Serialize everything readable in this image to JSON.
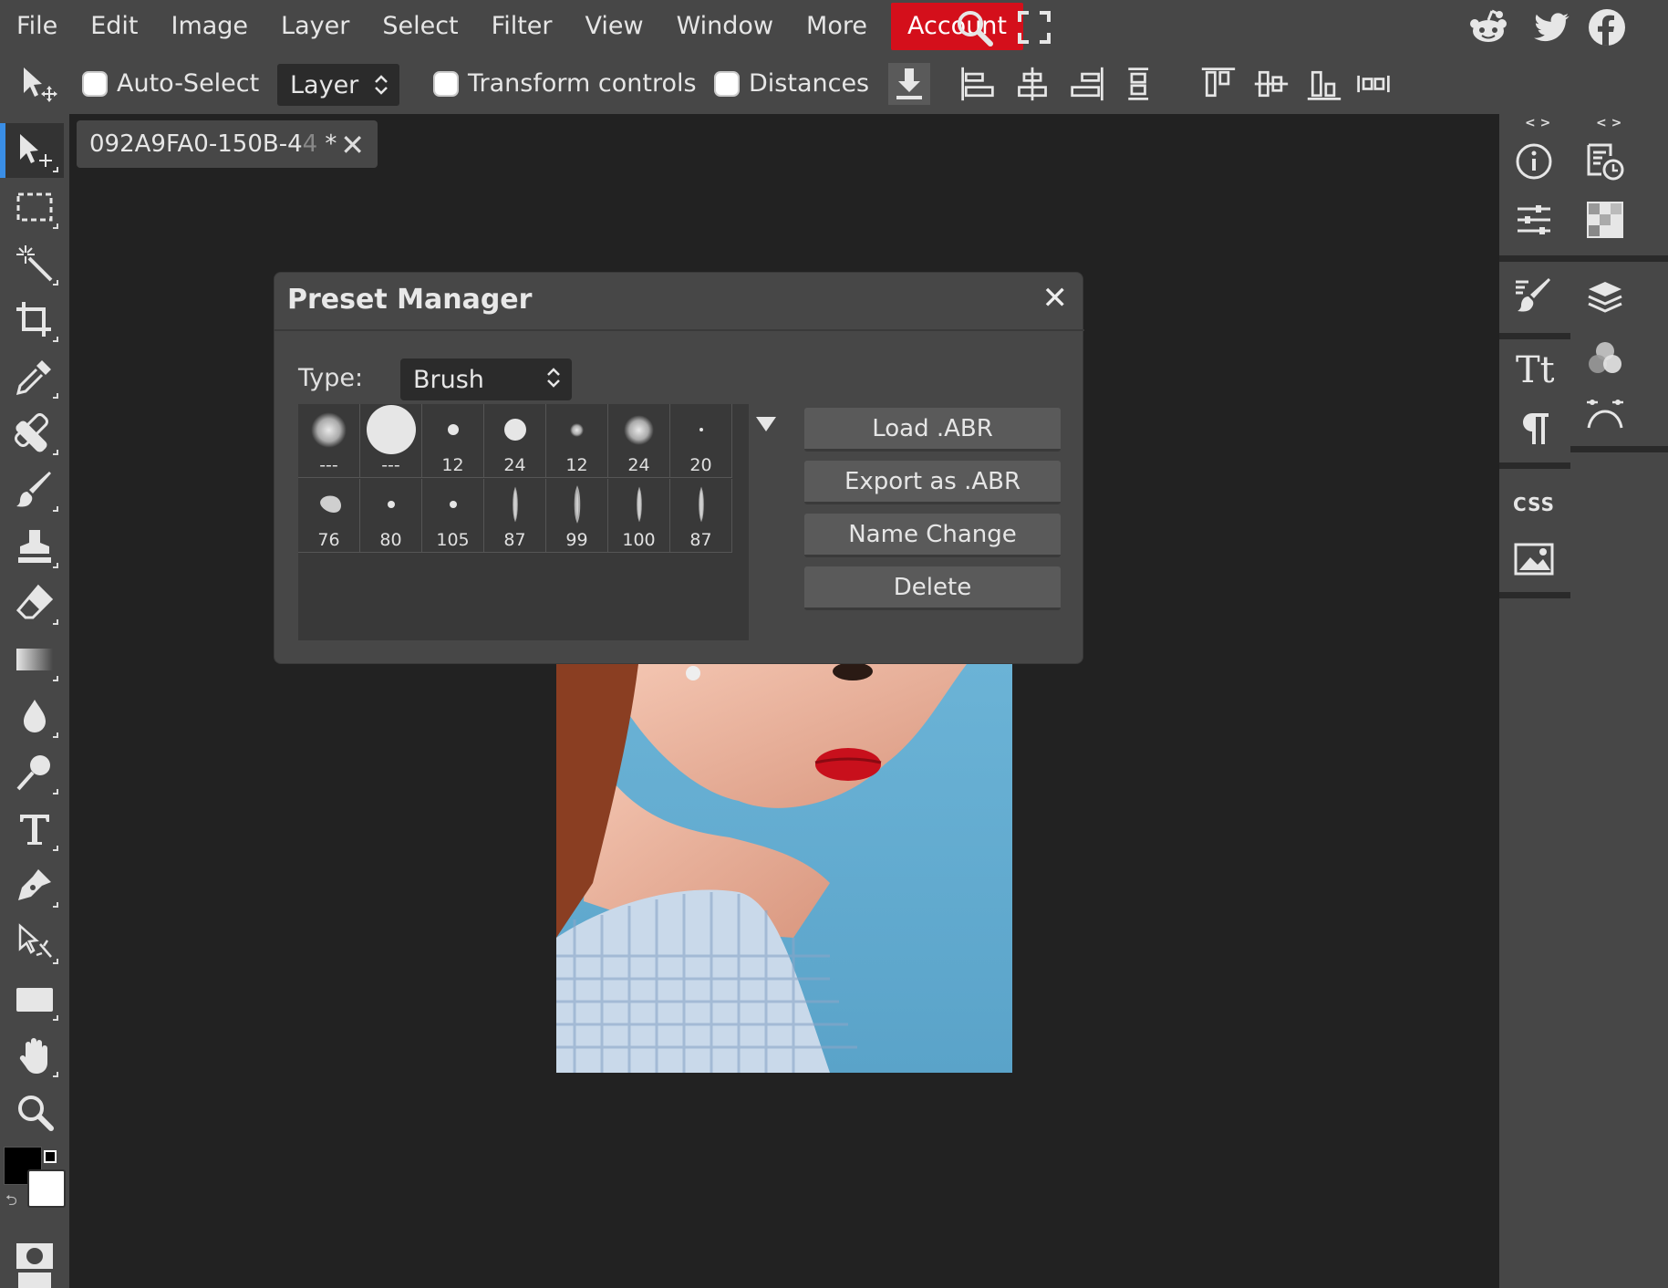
{
  "menu": {
    "items": [
      "File",
      "Edit",
      "Image",
      "Layer",
      "Select",
      "Filter",
      "View",
      "Window",
      "More"
    ],
    "account": "Account"
  },
  "options": {
    "auto_select": "Auto-Select",
    "layer_select": "Layer",
    "transform_controls": "Transform controls",
    "distances": "Distances"
  },
  "document_tab": {
    "name": "092A9FA0-150B-4",
    "name_faded": "4",
    "modified": " *"
  },
  "dialog": {
    "title": "Preset Manager",
    "type_label": "Type:",
    "type_value": "Brush",
    "brushes": [
      "---",
      "---",
      "12",
      "24",
      "12",
      "24",
      "20",
      "76",
      "80",
      "105",
      "87",
      "99",
      "100",
      "87"
    ],
    "buttons": [
      "Load .ABR",
      "Export as .ABR",
      "Name Change",
      "Delete"
    ]
  },
  "colors": {
    "accent": "#3a8ee6",
    "account_red": "#d40f1b",
    "panel": "#474747",
    "canvas_bg": "#222222",
    "foreground_color": "#000000",
    "background_color": "#ffffff"
  },
  "icons": {
    "top_right": [
      "reddit-icon",
      "twitter-icon",
      "facebook-icon"
    ],
    "tools": [
      "move-tool-icon",
      "marquee-icon",
      "magic-wand-icon",
      "crop-icon",
      "eyedropper-icon",
      "healing-icon",
      "brush-icon",
      "stamp-icon",
      "eraser-icon",
      "gradient-icon",
      "blur-icon",
      "dodge-icon",
      "text-icon",
      "pen-icon",
      "path-select-icon",
      "shape-icon",
      "hand-icon",
      "zoom-icon",
      "quick-mask-icon"
    ],
    "right_panel": [
      "info-icon",
      "history-icon",
      "adjustments-icon",
      "swatches-icon",
      "brush-settings-icon",
      "layers-icon",
      "character-icon",
      "channels-icon",
      "paragraph-icon",
      "paths-icon",
      "css-icon",
      "image-icon"
    ]
  },
  "right_panel_css": "CSS"
}
